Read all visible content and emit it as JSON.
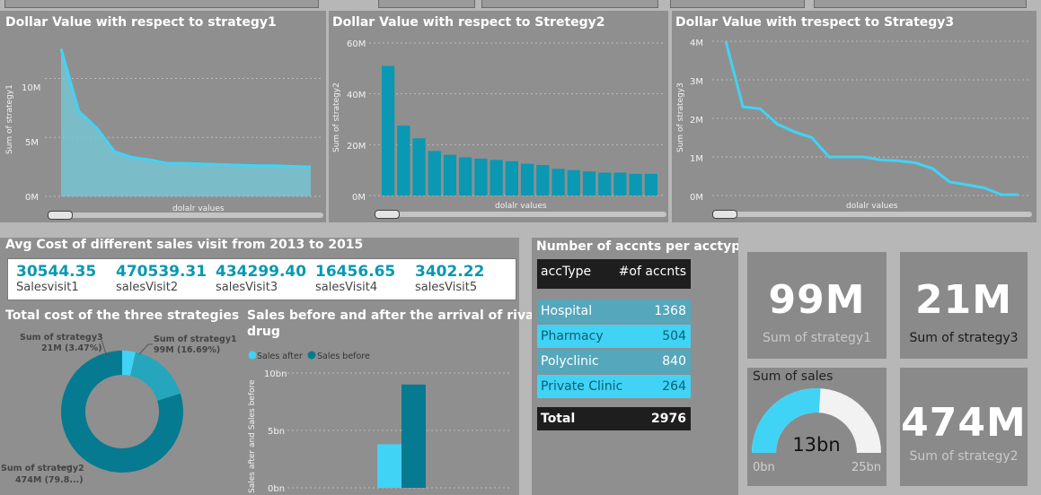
{
  "charts": {
    "strategy1": {
      "title": "Dollar Value with respect to strategy1",
      "ylabel": "Sum of strategy1",
      "xlabel": "dolalr values",
      "ticks": [
        "0M",
        "5M",
        "10M"
      ]
    },
    "strategy2": {
      "title": "Dollar Value with respect to Stretegy2",
      "ylabel": "Sum of strategy2",
      "xlabel": "dolalr values",
      "ticks": [
        "0M",
        "20M",
        "40M",
        "60M"
      ]
    },
    "strategy3": {
      "title": "Dollar Value with trespect to Strategy3",
      "ylabel": "Sum of strategy3",
      "xlabel": "dolalr values",
      "ticks": [
        "0M",
        "1M",
        "2M",
        "3M",
        "4M"
      ]
    },
    "donut": {
      "title": "Total cost of the three strategies",
      "labels": {
        "s3_name": "Sum of strategy3",
        "s3_value": "21M (3.47%)",
        "s1_name": "Sum of strategy1",
        "s1_value": "99M (16.69%)",
        "s2_name": "Sum of strategy2",
        "s2_value": "474M (79.8...)"
      }
    },
    "rival": {
      "title_line1": "Sales before and after the arrival of rival",
      "title_line2": "drug",
      "legend_after": "Sales after",
      "legend_before": "Sales before",
      "ylabel": "Sales after and Sales before",
      "ticks": [
        "0bn",
        "5bn",
        "10bn"
      ]
    }
  },
  "chart_data": [
    {
      "type": "area",
      "title": "Dollar Value with respect to strategy1",
      "xlabel": "dolalr values",
      "ylabel": "Sum of strategy1",
      "ylim": [
        0,
        13
      ],
      "series": [
        {
          "values": [
            12.5,
            7.2,
            5.8,
            3.8,
            3.3,
            3.1,
            2.8,
            2.8,
            2.75,
            2.7,
            2.65,
            2.6,
            2.6,
            2.55,
            2.5
          ]
        }
      ]
    },
    {
      "type": "bar",
      "title": "Dollar Value with respect to Stretegy2",
      "xlabel": "dolalr values",
      "ylabel": "Sum of strategy2",
      "ylim": [
        0,
        60
      ],
      "values": [
        51,
        27.5,
        22.5,
        17.5,
        16,
        15,
        14.5,
        14,
        13.5,
        12.5,
        12,
        10.5,
        10,
        9.5,
        9,
        9,
        8.5,
        8.5
      ]
    },
    {
      "type": "line",
      "title": "Dollar Value with trespect to Strategy3",
      "xlabel": "dolalr values",
      "ylabel": "Sum of strategy3",
      "ylim": [
        0,
        4
      ],
      "series": [
        {
          "values": [
            4.0,
            2.3,
            2.25,
            1.85,
            1.65,
            1.5,
            1.0,
            1.0,
            1.0,
            0.92,
            0.9,
            0.85,
            0.7,
            0.35,
            0.28,
            0.2,
            0.02,
            0.02
          ]
        }
      ]
    },
    {
      "type": "pie",
      "title": "Total cost of the three strategies",
      "categories": [
        "Sum of strategy1",
        "Sum of strategy2",
        "Sum of strategy3"
      ],
      "values": [
        99,
        474,
        21
      ],
      "percents": [
        16.69,
        79.84,
        3.47
      ]
    },
    {
      "type": "bar",
      "title": "Sales before and after the arrival of rival drug",
      "ylabel": "Sales after and Sales before",
      "ylim": [
        0,
        10
      ],
      "series": [
        {
          "name": "Sales after",
          "values": [
            3.8
          ]
        },
        {
          "name": "Sales before",
          "values": [
            9
          ]
        }
      ]
    }
  ],
  "avgcost": {
    "title": "Avg Cost of different sales visit from 2013 to 2015",
    "items": [
      {
        "value": "30544.35",
        "label": "Salesvisit1"
      },
      {
        "value": "470539.31",
        "label": "salesVisit2"
      },
      {
        "value": "434299.40",
        "label": "salesVisit3"
      },
      {
        "value": "16456.65",
        "label": "salesVisit4"
      },
      {
        "value": "3402.22",
        "label": "salesVisit5"
      }
    ]
  },
  "accounts": {
    "title": "Number of accnts per acctype",
    "col1": "accType",
    "col2": "#of accnts",
    "rows": [
      {
        "type": "Hospital",
        "count": "1368"
      },
      {
        "type": "Pharmacy",
        "count": "504"
      },
      {
        "type": "Polyclinic",
        "count": "840"
      },
      {
        "type": "Private Clinic",
        "count": "264"
      }
    ],
    "total_label": "Total",
    "total_value": "2976"
  },
  "cards": {
    "s1": {
      "value": "99M",
      "label": "Sum of strategy1"
    },
    "s3": {
      "value": "21M",
      "label": "Sum of strategy3"
    },
    "s2": {
      "value": "474M",
      "label": "Sum of strategy2"
    },
    "gauge": {
      "title": "Sum of sales",
      "value": "13bn",
      "min": "0bn",
      "max": "25bn",
      "fraction": 0.52
    }
  },
  "colors": {
    "accent": "#0a98b2",
    "light": "#41d3f5",
    "dark": "#057a91",
    "panel": "#8f8f8f"
  }
}
